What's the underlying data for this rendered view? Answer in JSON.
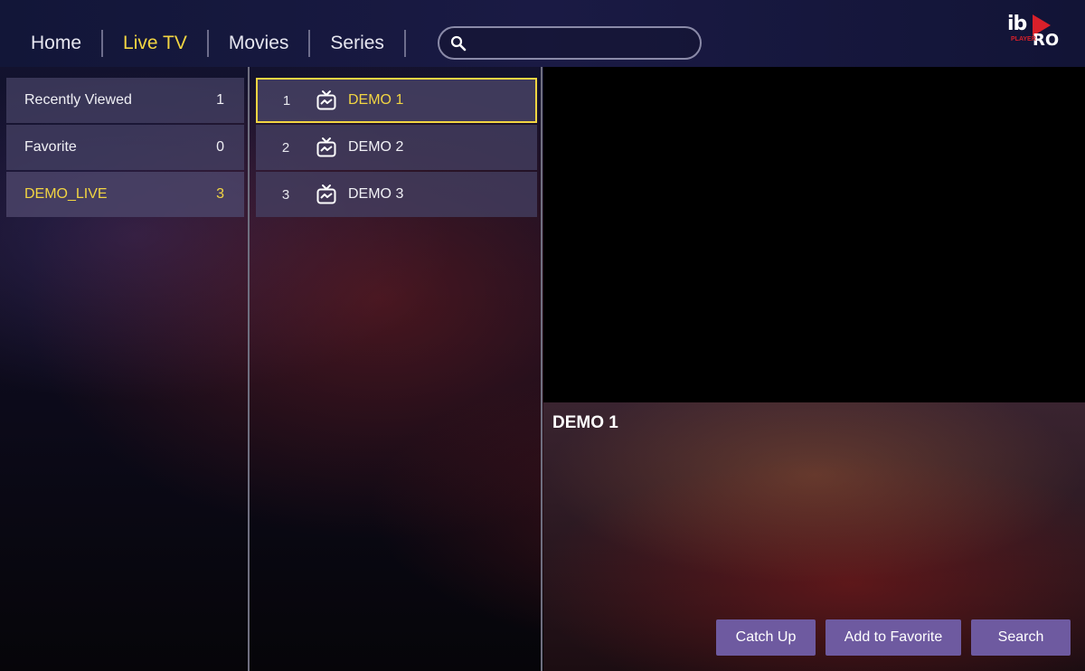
{
  "nav": {
    "items": [
      {
        "label": "Home",
        "active": false
      },
      {
        "label": "Live TV",
        "active": true
      },
      {
        "label": "Movies",
        "active": false
      },
      {
        "label": "Series",
        "active": false
      }
    ]
  },
  "search": {
    "placeholder": "",
    "value": ""
  },
  "logo": {
    "text": "ib",
    "pro": "RO",
    "player": "PLAYER"
  },
  "categories": [
    {
      "label": "Recently Viewed",
      "count": "1"
    },
    {
      "label": "Favorite",
      "count": "0"
    },
    {
      "label": "DEMO_LIVE",
      "count": "3"
    }
  ],
  "channels": [
    {
      "number": "1",
      "name": "DEMO 1"
    },
    {
      "number": "2",
      "name": "DEMO 2"
    },
    {
      "number": "3",
      "name": "DEMO 3"
    }
  ],
  "info": {
    "title": "DEMO 1"
  },
  "actions": {
    "catch_up": "Catch Up",
    "add_favorite": "Add to Favorite",
    "search": "Search"
  },
  "colors": {
    "accent": "#f2d542",
    "button": "#6e5aa0",
    "logo_red": "#d8202a"
  }
}
